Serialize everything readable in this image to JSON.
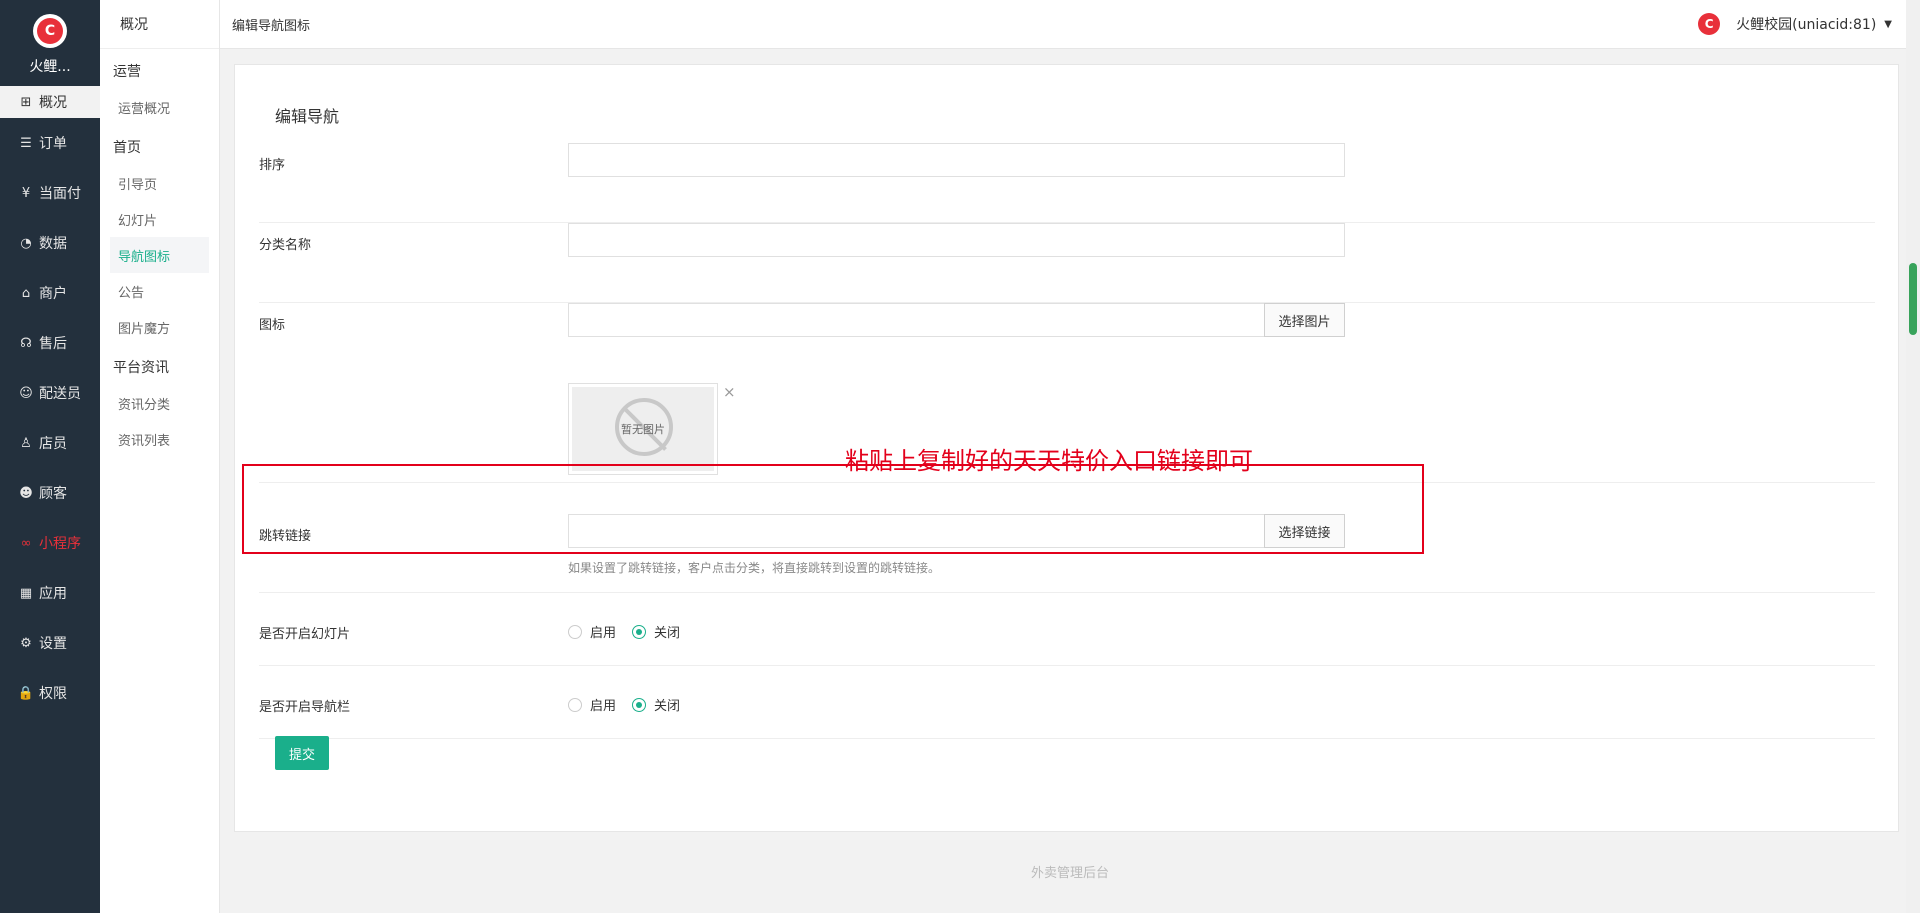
{
  "brand": {
    "logo_letter": "C",
    "name": "火鲤..."
  },
  "dark_menu": [
    {
      "icon": "overview-icon",
      "glyph": "⊞",
      "label": "概况"
    },
    {
      "icon": "order-icon",
      "glyph": "☰",
      "label": "订单"
    },
    {
      "icon": "yen-icon",
      "glyph": "¥",
      "label": "当面付"
    },
    {
      "icon": "chart-icon",
      "glyph": "◔",
      "label": "数据"
    },
    {
      "icon": "shop-icon",
      "glyph": "⌂",
      "label": "商户"
    },
    {
      "icon": "aftersale-icon",
      "glyph": "☊",
      "label": "售后"
    },
    {
      "icon": "courier-icon",
      "glyph": "☺",
      "label": "配送员"
    },
    {
      "icon": "clerk-icon",
      "glyph": "♙",
      "label": "店员"
    },
    {
      "icon": "customer-icon",
      "glyph": "☻",
      "label": "顾客"
    },
    {
      "icon": "miniprogram-icon",
      "glyph": "∞",
      "label": "小程序"
    },
    {
      "icon": "apps-icon",
      "glyph": "▦",
      "label": "应用"
    },
    {
      "icon": "settings-icon",
      "glyph": "⚙",
      "label": "设置"
    },
    {
      "icon": "lock-icon",
      "glyph": "🔒",
      "label": "权限"
    }
  ],
  "sub_menu": {
    "top": "概况",
    "groups": [
      {
        "title": "运营",
        "items": [
          "运营概况"
        ]
      },
      {
        "title": "首页",
        "items": [
          "引导页",
          "幻灯片",
          "导航图标",
          "公告",
          "图片魔方"
        ]
      },
      {
        "title": "平台资讯",
        "items": [
          "资讯分类",
          "资讯列表"
        ]
      }
    ],
    "active_item": "导航图标"
  },
  "topbar": {
    "breadcrumb": "编辑导航图标",
    "user_name": "火鲤校园(uniacid:81)",
    "user_logo_letter": "C"
  },
  "form": {
    "title": "编辑导航",
    "sort_label": "排序",
    "sort_value": "",
    "category_label": "分类名称",
    "category_value": "",
    "icon_label": "图标",
    "icon_value": "",
    "select_image_button": "选择图片",
    "no_image_text": "暂无图片",
    "remove_glyph": "×",
    "link_label": "跳转链接",
    "link_value": "",
    "select_link_button": "选择链接",
    "link_hint": "如果设置了跳转链接，客户点击分类，将直接跳转到设置的跳转链接。",
    "slideshow_label": "是否开启幻灯片",
    "navbar_label": "是否开启导航栏",
    "enable_label": "启用",
    "disable_label": "关闭",
    "slideshow_selected": "关闭",
    "navbar_selected": "关闭",
    "submit_button": "提交"
  },
  "annotation": {
    "text": "粘贴上复制好的天天特价入口链接即可",
    "color": "#e3001b"
  },
  "footer": "外卖管理后台",
  "colors": {
    "sidebar": "#23303d",
    "accent": "#1aaf8b",
    "brand_red": "#e8303a"
  }
}
